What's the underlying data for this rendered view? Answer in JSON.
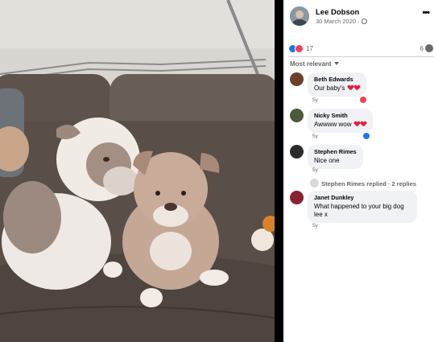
{
  "post": {
    "author": "Lee Dobson",
    "date": "30 March 2020",
    "privacy_separator": " · ",
    "privacy_icon": "globe-icon",
    "more_label": "•••"
  },
  "photo": {
    "subject": "two bulldog puppies on a grey leather sofa",
    "icons": [
      "sofa",
      "puppy",
      "toy"
    ]
  },
  "reactions": {
    "count": "17",
    "comment_count": "6",
    "types": [
      "like",
      "love"
    ]
  },
  "sort": {
    "label": "Most relevant"
  },
  "comments": [
    {
      "name": "Beth Edwards",
      "text": "Our baby's",
      "age": "5y",
      "reaction": "love",
      "avatar_color": "#6b3f2a"
    },
    {
      "name": "Nicky Smith",
      "text": "Awwww wow",
      "age": "5y",
      "reaction": "like",
      "avatar_color": "#4a5a3a"
    },
    {
      "name": "Stephen Rimes",
      "text": "Nice one",
      "age": "5y",
      "reaction": "",
      "avatar_color": "#2b2b2b"
    },
    {
      "name": "Janet Dunkley",
      "text": "What happened to your big dog lee x",
      "age": "5y",
      "reaction": "",
      "avatar_color": "#8a2231"
    }
  ],
  "replies": {
    "label": "Stephen Rimes replied · 2 replies"
  },
  "colors": {
    "facebook_blue": "#1877f2",
    "love_red": "#f33e58",
    "bubble_grey": "#f0f2f5",
    "muted_text": "#65676b"
  }
}
